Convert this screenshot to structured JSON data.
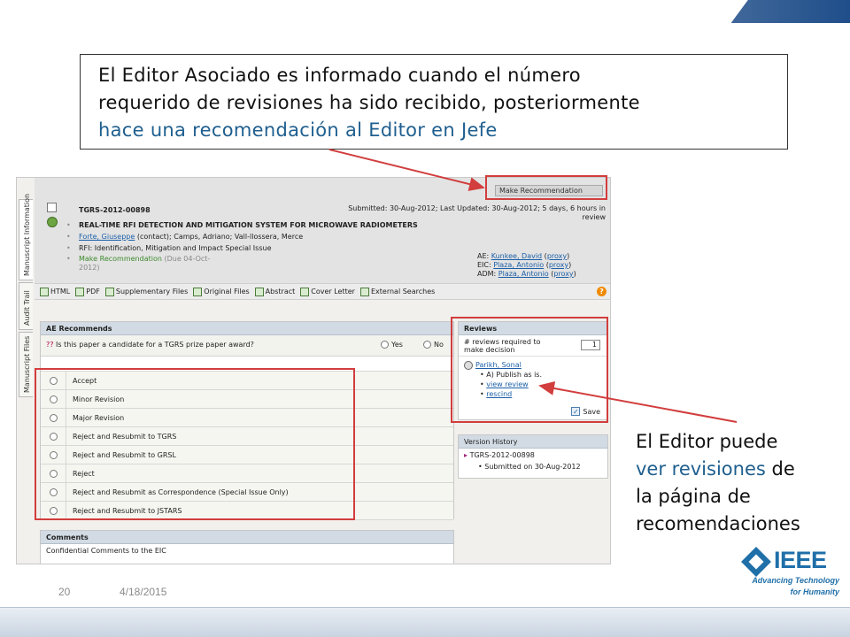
{
  "slide": {
    "callout_top_line1": "El Editor Asociado es informado cuando el número",
    "callout_top_line2": "requerido de revisiones ha sido recibido, posteriormente",
    "callout_top_line3": "hace una recomendación al Editor en Jefe",
    "side_line1": "El Editor puede",
    "side_line2": "ver revisiones",
    "side_line2b": " de",
    "side_line3": "la página de",
    "side_line4": "recomendaciones",
    "page_number": "20",
    "date": "4/18/2015",
    "logo_word": "IEEE",
    "logo_tag1": "Advancing Technology",
    "logo_tag2": "for Humanity"
  },
  "vtabs": [
    "Manuscript Information",
    "Audit Trail",
    "Manuscript Files"
  ],
  "manuscript": {
    "make_rec_button": "Make Recommendation",
    "id": "TGRS-2012-00898",
    "dates_line1": "Submitted: 30-Aug-2012; Last Updated: 30-Aug-2012; 5 days, 6 hours in",
    "dates_line2": "review",
    "title": "REAL-TIME RFI DETECTION AND MITIGATION SYSTEM FOR MICROWAVE RADIOMETERS",
    "author_link": "Forte, Giuseppe",
    "authors_rest": " (contact); Camps, Adriano; Vall-llossera, Merce",
    "rfi": "RFI: Identification, Mitigation and Impact Special Issue",
    "make_rec": "Make Recommendation",
    "due_line1": " (Due 04-Oct-",
    "due_line2": "2012)",
    "ae_label": "AE: ",
    "ae_name": "Kunkee, David",
    "eic_label": "EIC: ",
    "eic_name": "Plaza, Antonio",
    "adm_label": "ADM: ",
    "adm_name": "Plaza, Antonio",
    "proxy": "proxy"
  },
  "toolbar": [
    "HTML",
    "PDF",
    "Supplementary Files",
    "Original Files",
    "Abstract",
    "Cover Letter",
    "External Searches"
  ],
  "ae": {
    "header": "AE Recommends",
    "prize_question": "Is this paper a candidate for a TGRS prize paper award?",
    "yes": "Yes",
    "no": "No",
    "options": [
      "Accept",
      "Minor Revision",
      "Major Revision",
      "Reject and Resubmit to TGRS",
      "Reject and Resubmit to GRSL",
      "Reject",
      "Reject and Resubmit as Correspondence (Special Issue Only)",
      "Reject and Resubmit to JSTARS"
    ]
  },
  "comments": {
    "header": "Comments",
    "sub": "Confidential Comments to the EIC"
  },
  "reviews": {
    "header": "Reviews",
    "required_line1": "# reviews required to",
    "required_line2": "make decision",
    "required_value": "1",
    "reviewer": "Parikh, Sonal",
    "decision": "A) Publish as is.",
    "view_review": "view review",
    "rescind": "rescind",
    "save": "Save"
  },
  "version_history": {
    "header": "Version History",
    "id": "TGRS-2012-00898",
    "submitted": "Submitted on 30-Aug-2012"
  },
  "colors": {
    "accent_red": "#d23d3d",
    "link_blue": "#1b5fa8",
    "text_blue": "#1f5f8f",
    "ieee_blue": "#1f6fa9"
  }
}
